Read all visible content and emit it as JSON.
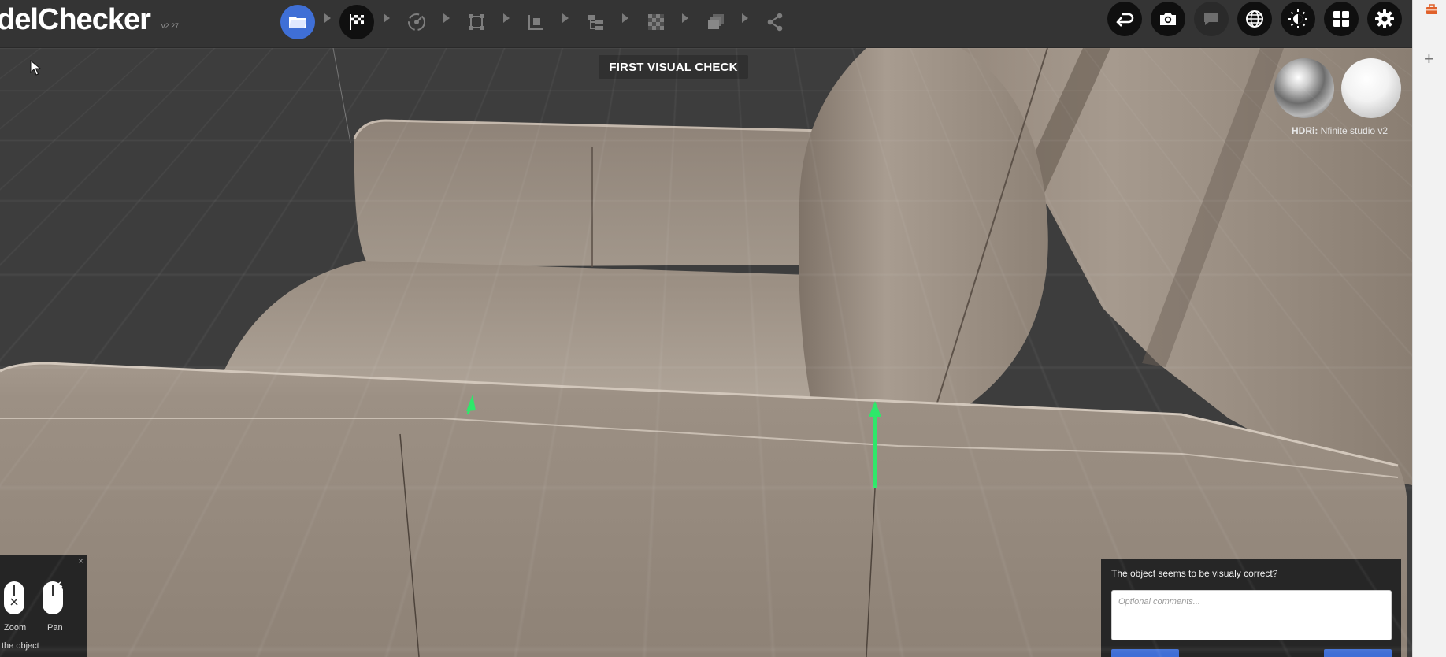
{
  "app": {
    "logo_text": "delChecker",
    "version": "v2.27"
  },
  "workflow_steps": [
    {
      "id": "load",
      "icon": "folder-icon",
      "state": "active"
    },
    {
      "id": "visual-check",
      "icon": "checkered-flag-icon",
      "state": "current"
    },
    {
      "id": "rig",
      "icon": "gizmo-icon",
      "state": "disabled"
    },
    {
      "id": "bounds",
      "icon": "bounding-box-icon",
      "state": "disabled"
    },
    {
      "id": "pivot",
      "icon": "pivot-icon",
      "state": "disabled"
    },
    {
      "id": "hierarchy",
      "icon": "hierarchy-icon",
      "state": "disabled"
    },
    {
      "id": "uv",
      "icon": "checker-texture-icon",
      "state": "disabled"
    },
    {
      "id": "materials",
      "icon": "layers-icon",
      "state": "disabled"
    },
    {
      "id": "share",
      "icon": "share-icon",
      "state": "disabled"
    }
  ],
  "toolbar": [
    {
      "icon": "return-icon"
    },
    {
      "icon": "camera-icon"
    },
    {
      "icon": "comment-icon"
    },
    {
      "icon": "globe-icon"
    },
    {
      "icon": "exposure-icon"
    },
    {
      "icon": "grid-layout-icon"
    },
    {
      "icon": "gear-icon"
    }
  ],
  "viewport": {
    "stage_title": "FIRST VISUAL CHECK",
    "hdri_label": "HDRi:",
    "hdri_value": "Nfinite studio v2"
  },
  "help_panel": {
    "close": "×",
    "zoom_label": "Zoom",
    "pan_label": "Pan",
    "hint_text": "the object"
  },
  "validation": {
    "question": "The object seems to be visualy correct?",
    "placeholder": "Optional comments..."
  },
  "side": {
    "plus": "+"
  },
  "colors": {
    "accent": "#3f6fd6",
    "topbar": "#343434",
    "leather": "#a69889",
    "normal_arrow": "#2ee86a"
  }
}
